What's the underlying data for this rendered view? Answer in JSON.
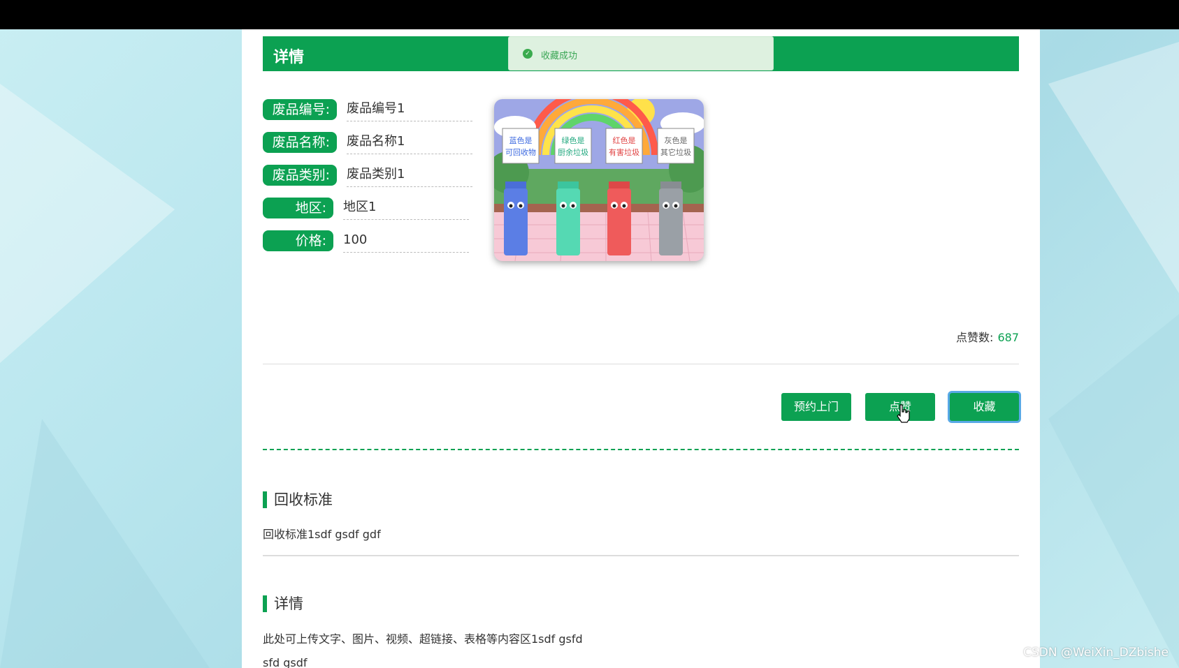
{
  "header": {
    "title": "详情"
  },
  "toast": {
    "message": "收藏成功"
  },
  "fields": [
    {
      "label": "废品编号:",
      "value": "废品编号1"
    },
    {
      "label": "废品名称:",
      "value": "废品名称1"
    },
    {
      "label": "废品类别:",
      "value": "废品类别1"
    },
    {
      "label": "地区:",
      "value": "地区1"
    },
    {
      "label": "价格:",
      "value": "100"
    }
  ],
  "image": {
    "bins": [
      {
        "line1": "蓝色是",
        "line2": "可回收物",
        "color": "#5b7ee5"
      },
      {
        "line1": "绿色是",
        "line2": "厨余垃圾",
        "color": "#55d9b3"
      },
      {
        "line1": "红色是",
        "line2": "有害垃圾",
        "color": "#ef5b5b"
      },
      {
        "line1": "灰色是",
        "line2": "其它垃圾",
        "color": "#9aa0a6"
      }
    ]
  },
  "likes": {
    "label": "点赞数:",
    "count": "687"
  },
  "actions": {
    "appointment": "预约上门",
    "like": "点赞",
    "favorite": "收藏"
  },
  "standard": {
    "title": "回收标准",
    "text": "回收标准1sdf gsdf gdf"
  },
  "details": {
    "title": "详情",
    "text1": "此处可上传文字、图片、视频、超链接、表格等内容区1sdf gsfd",
    "text2": "sfd gsdf"
  },
  "watermark": "CSDN @WeiXin_DZbishe",
  "colors": {
    "primary": "#0ca152",
    "toast_bg": "#def1e0",
    "focus_ring": "#59a9e6"
  }
}
